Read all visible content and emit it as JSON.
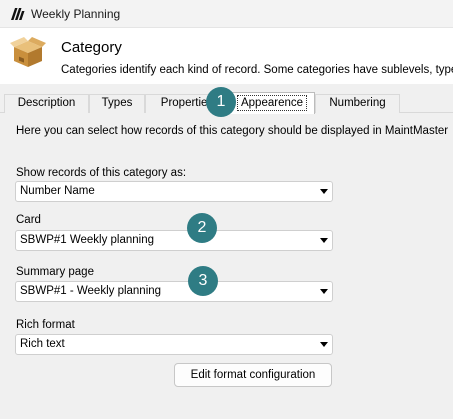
{
  "window": {
    "title": "Weekly Planning",
    "logo_icon": "app-logo-icon"
  },
  "header": {
    "title": "Category",
    "subtitle": "Categories identify each kind of record. Some categories have sublevels, type",
    "icon": "box-icon"
  },
  "tabs": [
    {
      "label": "Description",
      "active": false
    },
    {
      "label": "Types",
      "active": false
    },
    {
      "label": "Properties",
      "active": false
    },
    {
      "label": "Appearence",
      "active": true
    },
    {
      "label": "Numbering",
      "active": false
    }
  ],
  "panel": {
    "intro": "Here you can select how records of this category should be displayed in MaintMaster",
    "show_records": {
      "label": "Show records of this category as:",
      "value": "Number Name"
    },
    "card": {
      "label": "Card",
      "value": "SBWP#1 Weekly planning"
    },
    "summary_page": {
      "label": "Summary page",
      "value": "SBWP#1 - Weekly planning"
    },
    "rich_format": {
      "label": "Rich format",
      "value": "Rich text"
    },
    "edit_button": "Edit format configuration"
  },
  "badges": [
    "1",
    "2",
    "3"
  ],
  "colors": {
    "badge": "#2f7c84",
    "header_bg": "#ffffff",
    "panel_bg": "#f0f0f0"
  }
}
